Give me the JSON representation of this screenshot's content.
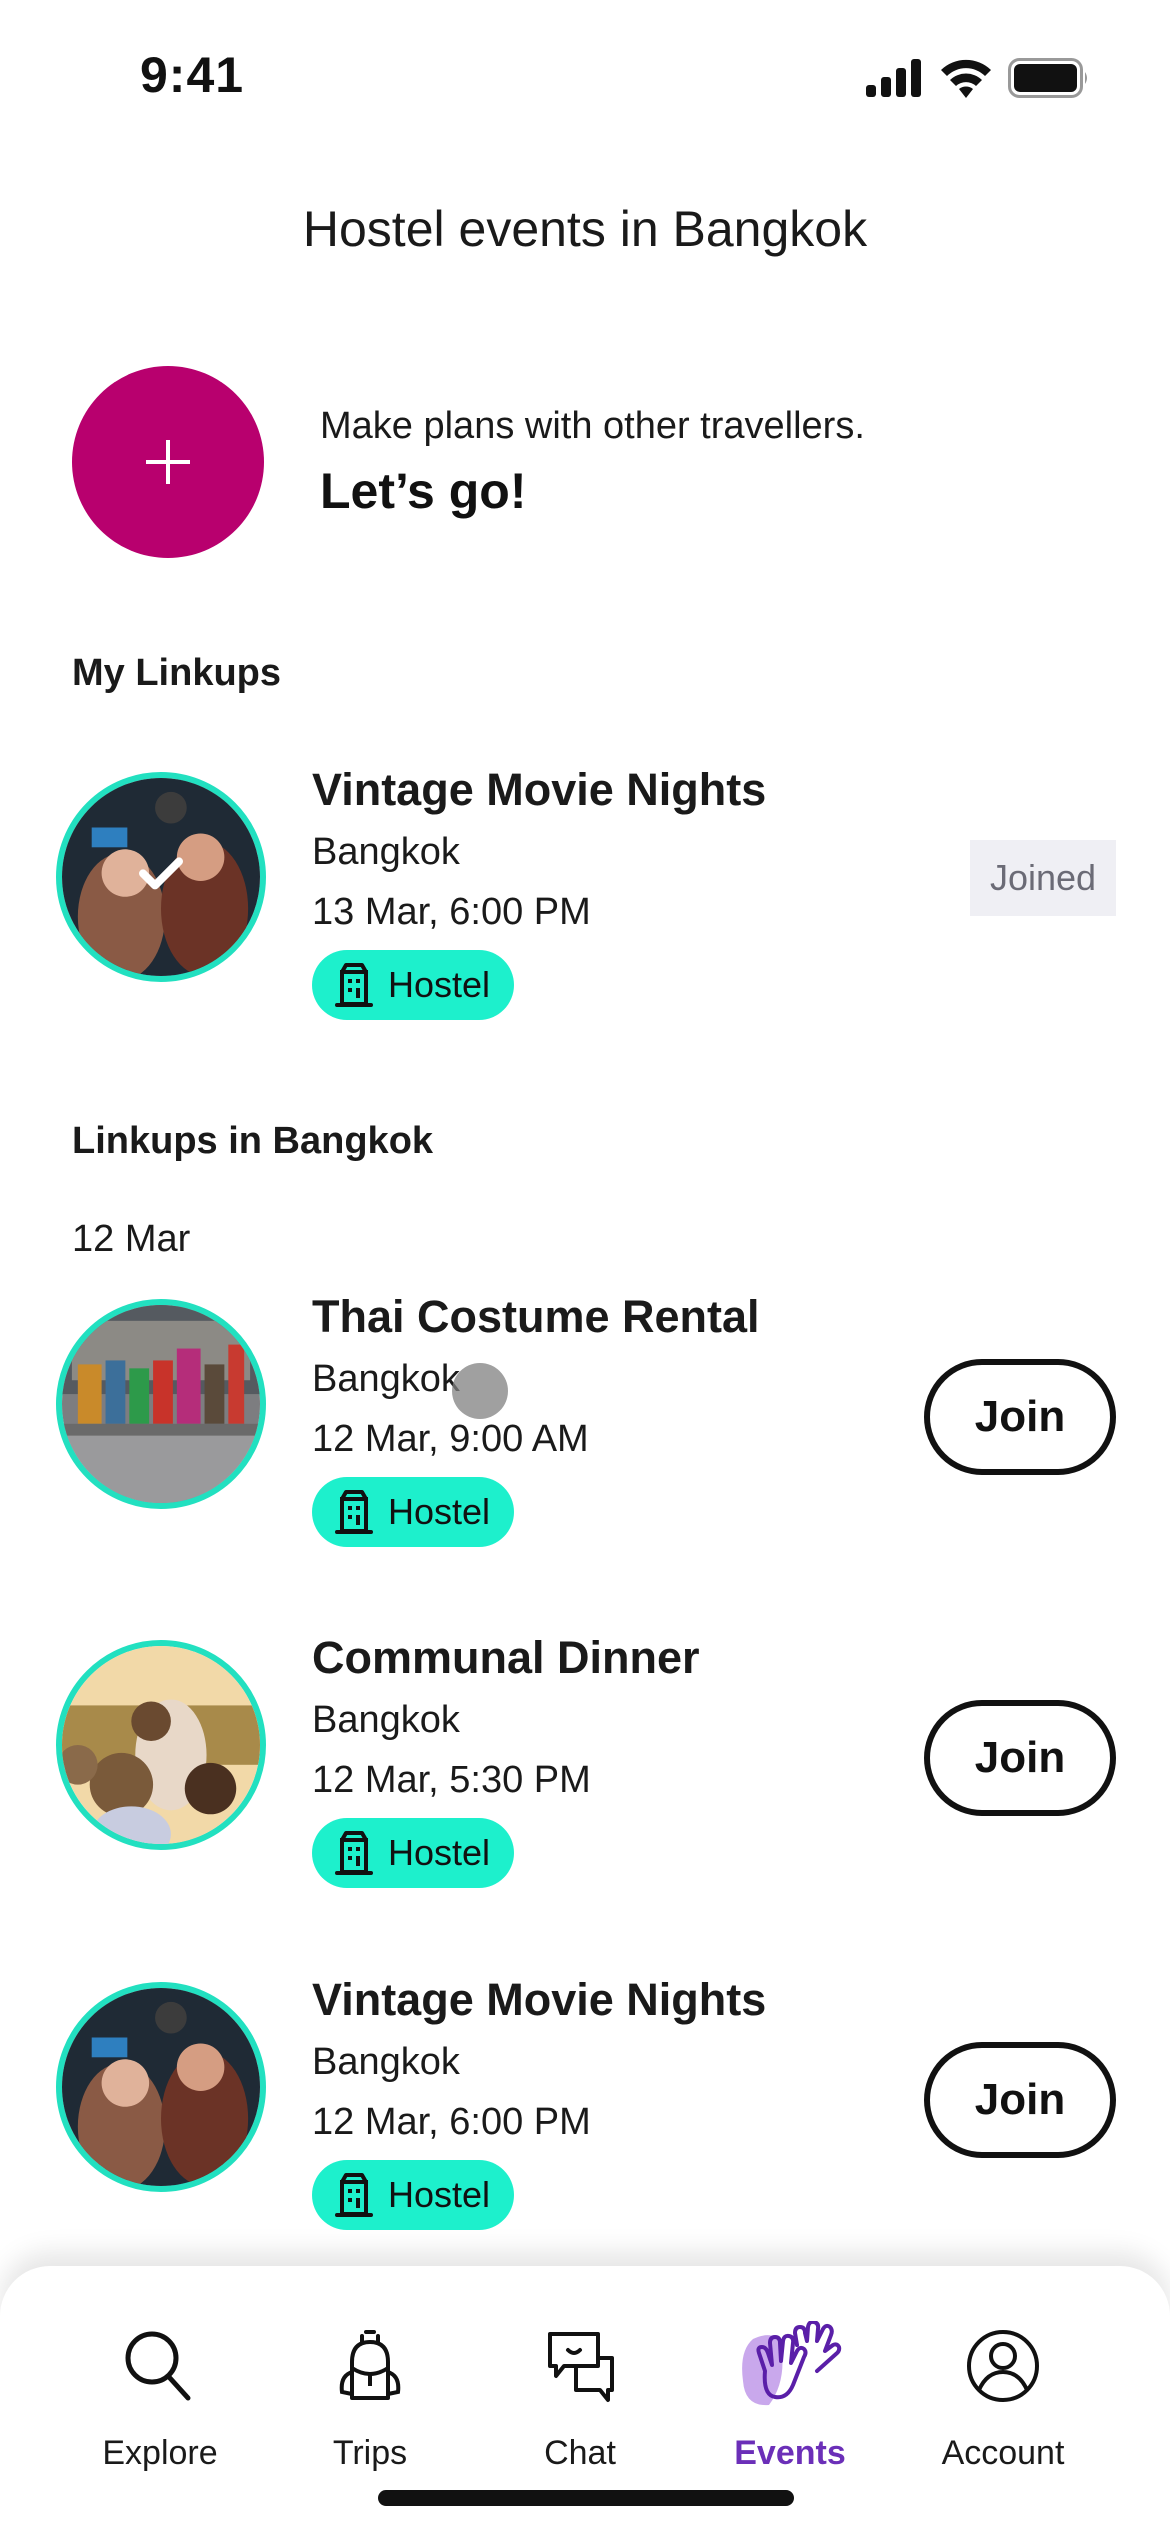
{
  "status_bar": {
    "time": "9:41"
  },
  "header": {
    "title": "Hostel events in Bangkok"
  },
  "create": {
    "subtitle": "Make plans with other travellers.",
    "cta": "Let’s go!",
    "icon": "plus-icon",
    "color": "#b8006e"
  },
  "my_linkups": {
    "title": "My Linkups",
    "items": [
      {
        "title": "Vintage Movie Nights",
        "city": "Bangkok",
        "datetime": "13 Mar, 6:00 PM",
        "badge": "Hostel",
        "status": "Joined",
        "image": "movie-night-photo"
      }
    ]
  },
  "linkups": {
    "title": "Linkups in Bangkok",
    "date_group": "12 Mar",
    "join_label": "Join",
    "items": [
      {
        "title": "Thai Costume Rental",
        "city": "Bangkok",
        "datetime": "12 Mar, 9:00 AM",
        "badge": "Hostel",
        "image": "costume-photo"
      },
      {
        "title": "Communal Dinner",
        "city": "Bangkok",
        "datetime": "12 Mar, 5:30 PM",
        "badge": "Hostel",
        "image": "dinner-photo"
      },
      {
        "title": "Vintage Movie Nights",
        "city": "Bangkok",
        "datetime": "12 Mar, 6:00 PM",
        "badge": "Hostel",
        "image": "movie-night-photo"
      }
    ]
  },
  "tabbar": {
    "items": [
      {
        "label": "Explore",
        "icon": "search-icon"
      },
      {
        "label": "Trips",
        "icon": "backpack-icon"
      },
      {
        "label": "Chat",
        "icon": "chat-icon"
      },
      {
        "label": "Events",
        "icon": "high-five-icon",
        "active": true
      },
      {
        "label": "Account",
        "icon": "account-icon"
      }
    ]
  },
  "colors": {
    "accent": "#1df0cc",
    "brand": "#b8006e",
    "active_tab": "#6b2fb8"
  }
}
